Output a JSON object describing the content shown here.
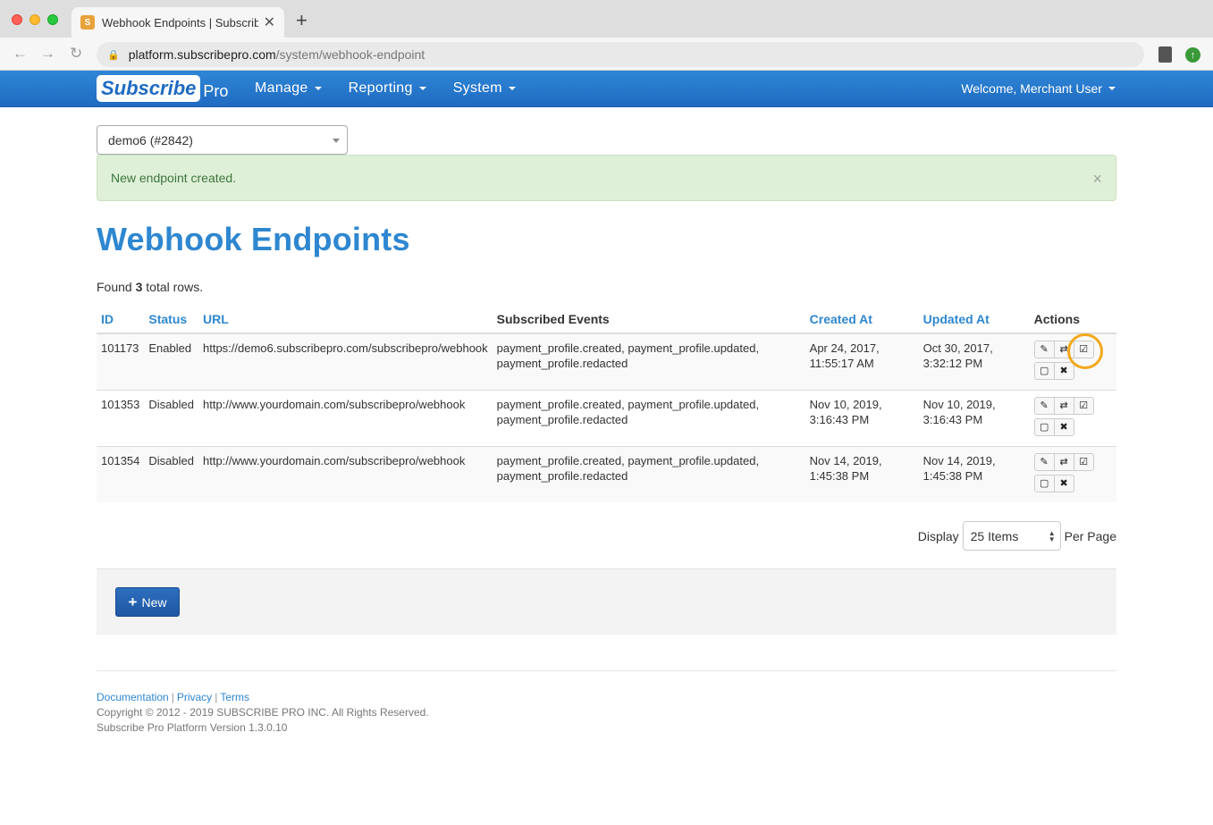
{
  "browser": {
    "tab_title": "Webhook Endpoints | Subscrib",
    "url_host": "platform.subscribepro.com",
    "url_path": "/system/webhook-endpoint"
  },
  "navbar": {
    "logo_main": "Subscribe",
    "logo_sub": "Pro",
    "menu": [
      "Manage",
      "Reporting",
      "System"
    ],
    "user": "Welcome, Merchant User"
  },
  "store_select": {
    "value": "demo6 (#2842)"
  },
  "alert": {
    "message": "New endpoint created.",
    "close": "×"
  },
  "page": {
    "title": "Webhook Endpoints",
    "found_prefix": "Found",
    "found_count": "3",
    "found_suffix": "total rows."
  },
  "table": {
    "headers": {
      "id": "ID",
      "status": "Status",
      "url": "URL",
      "events": "Subscribed Events",
      "created": "Created At",
      "updated": "Updated At",
      "actions": "Actions"
    },
    "rows": [
      {
        "id": "101173",
        "status": "Enabled",
        "url": "https://demo6.subscribepro.com/subscribepro/webhook",
        "events_1": "payment_profile.created, payment_profile.updated,",
        "events_2": "payment_profile.redacted",
        "created_1": "Apr 24, 2017,",
        "created_2": "11:55:17 AM",
        "updated_1": "Oct 30, 2017,",
        "updated_2": "3:32:12 PM"
      },
      {
        "id": "101353",
        "status": "Disabled",
        "url": "http://www.yourdomain.com/subscribepro/webhook",
        "events_1": "payment_profile.created, payment_profile.updated,",
        "events_2": "payment_profile.redacted",
        "created_1": "Nov 10, 2019,",
        "created_2": "3:16:43 PM",
        "updated_1": "Nov 10, 2019,",
        "updated_2": "3:16:43 PM"
      },
      {
        "id": "101354",
        "status": "Disabled",
        "url": "http://www.yourdomain.com/subscribepro/webhook",
        "events_1": "payment_profile.created, payment_profile.updated,",
        "events_2": "payment_profile.redacted",
        "created_1": "Nov 14, 2019,",
        "created_2": "1:45:38 PM",
        "updated_1": "Nov 14, 2019,",
        "updated_2": "1:45:38 PM"
      }
    ]
  },
  "pager": {
    "display_label": "Display",
    "per_page_value": "25 Items",
    "per_page_label": "Per Page"
  },
  "new_button": {
    "label": "New"
  },
  "footer": {
    "links": [
      "Documentation",
      "Privacy",
      "Terms"
    ],
    "copyright": "Copyright © 2012 - 2019 SUBSCRIBE PRO INC. All Rights Reserved.",
    "version": "Subscribe Pro Platform Version 1.3.0.10"
  },
  "colors": {
    "brand_blue": "#2e87d0",
    "highlight_ring": "#f3a81b",
    "alert_bg": "#dff0d8"
  }
}
